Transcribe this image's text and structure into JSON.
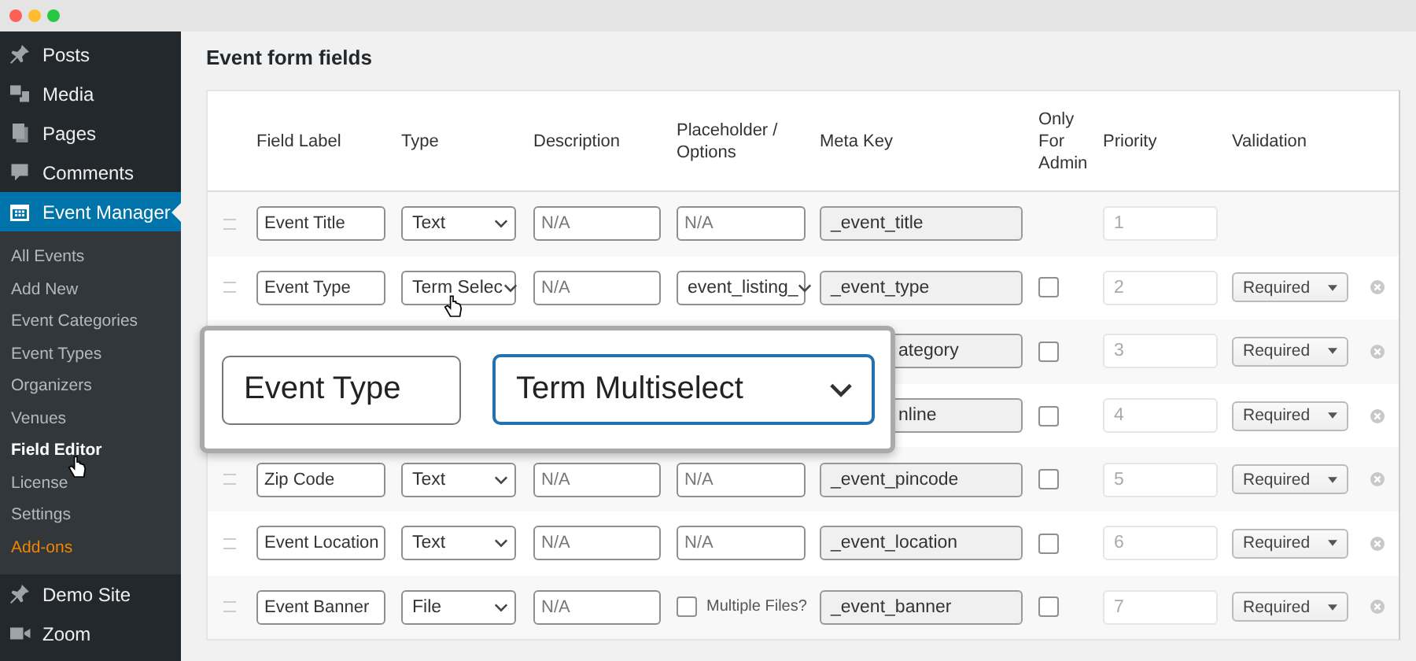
{
  "sidebar": {
    "menu_top": [
      {
        "label": "Posts",
        "selected": false
      },
      {
        "label": "Media",
        "selected": false
      },
      {
        "label": "Pages",
        "selected": false
      },
      {
        "label": "Comments",
        "selected": false
      },
      {
        "label": "Event Manager",
        "selected": true
      }
    ],
    "submenu": [
      {
        "label": "All Events",
        "selected": false,
        "kind": "link"
      },
      {
        "label": "Add New",
        "selected": false,
        "kind": "link"
      },
      {
        "label": "Event Categories",
        "selected": false,
        "kind": "link"
      },
      {
        "label": "Event Types",
        "selected": false,
        "kind": "link"
      },
      {
        "label": "Organizers",
        "selected": false,
        "kind": "link"
      },
      {
        "label": "Venues",
        "selected": false,
        "kind": "link"
      },
      {
        "label": "Field Editor",
        "selected": true,
        "kind": "link"
      },
      {
        "label": "License",
        "selected": false,
        "kind": "link"
      },
      {
        "label": "Settings",
        "selected": false,
        "kind": "link"
      },
      {
        "label": "Add-ons",
        "selected": false,
        "kind": "promo"
      }
    ],
    "menu_bottom": [
      {
        "label": "Demo Site",
        "selected": false
      },
      {
        "label": "Zoom",
        "selected": false
      }
    ]
  },
  "page_title": "Event form fields",
  "table": {
    "columns": [
      "Field Label",
      "Type",
      "Description",
      "Placeholder / Options",
      "Meta Key",
      "Only For Admin",
      "Priority",
      "Validation"
    ],
    "rows": [
      {
        "kind": "full",
        "label": "Event Title",
        "type": "Text",
        "description": {
          "placeholder": "N/A"
        },
        "options": {
          "kind": "text",
          "placeholder": "N/A"
        },
        "meta_key": "_event_title",
        "priority": "1"
      },
      {
        "kind": "full",
        "label": "Event Type",
        "type": "Term Selec",
        "description": {
          "placeholder": "N/A"
        },
        "options": {
          "kind": "select",
          "value": "event_listing_"
        },
        "meta_key": "_event_type",
        "only_for_admin": {
          "checked": false
        },
        "priority": "2",
        "validation": "Required"
      },
      {
        "kind": "covered",
        "meta_key": "ategory",
        "only_for_admin": {
          "checked": false
        },
        "priority": "3",
        "validation": "Required"
      },
      {
        "kind": "covered",
        "meta_key": "nline",
        "only_for_admin": {
          "checked": false
        },
        "priority": "4",
        "validation": "Required"
      },
      {
        "kind": "full",
        "label": "Zip Code",
        "type": "Text",
        "description": {
          "placeholder": "N/A"
        },
        "options": {
          "kind": "text",
          "placeholder": "N/A"
        },
        "meta_key": "_event_pincode",
        "only_for_admin": {
          "checked": false
        },
        "priority": "5",
        "validation": "Required"
      },
      {
        "kind": "full",
        "label": "Event Location",
        "type": "Text",
        "description": {
          "placeholder": "N/A"
        },
        "options": {
          "kind": "text",
          "placeholder": "N/A"
        },
        "meta_key": "_event_location",
        "only_for_admin": {
          "checked": false
        },
        "priority": "6",
        "validation": "Required"
      },
      {
        "kind": "full",
        "label": "Event Banner",
        "type": "File",
        "description": {
          "placeholder": "N/A"
        },
        "options": {
          "kind": "checkbox",
          "label": "Multiple Files?",
          "checked": false
        },
        "meta_key": "_event_banner",
        "only_for_admin": {
          "checked": false
        },
        "priority": "7",
        "validation": "Required"
      }
    ]
  },
  "zoom_callout": {
    "label": "Event Type",
    "type": "Term Multiselect"
  }
}
